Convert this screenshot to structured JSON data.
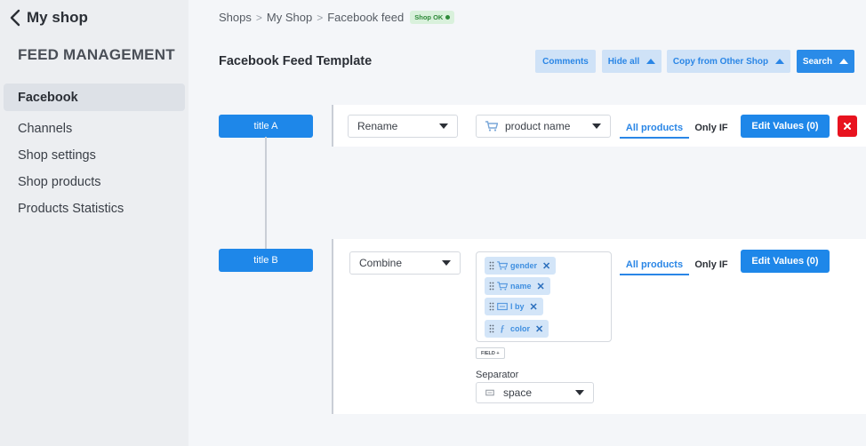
{
  "sidebar": {
    "back_label": "My shop",
    "section_title": "FEED MANAGEMENT",
    "items": [
      {
        "label": "Facebook",
        "active": true
      },
      {
        "label": "Channels"
      },
      {
        "label": "Shop settings"
      },
      {
        "label": "Shop products"
      },
      {
        "label": "Products Statistics"
      }
    ]
  },
  "breadcrumb": {
    "items": [
      "Shops",
      "My Shop",
      "Facebook feed"
    ],
    "badge": "Shop OK",
    "badge_color": "#2f8a3a"
  },
  "page": {
    "title": "Facebook Feed Template"
  },
  "toolbar": {
    "comments": "Comments",
    "hide_all": "Hide all",
    "copy": "Copy from Other Shop",
    "search": "Search"
  },
  "rules": [
    {
      "title": "title A",
      "action": "Rename",
      "field": "product name",
      "tab_all": "All products",
      "tab_only": "Only IF",
      "edit": "Edit Values (0)"
    },
    {
      "title": "title B",
      "action": "Combine",
      "tab_all": "All products",
      "tab_only": "Only IF",
      "edit": "Edit Values (0)",
      "chips": [
        {
          "label": "gender",
          "icon": "cart-icon"
        },
        {
          "label": "name",
          "icon": "cart-icon"
        },
        {
          "label": "l by",
          "icon": "text-field-icon"
        },
        {
          "label": "color",
          "icon": "function-icon"
        }
      ],
      "field_button": "FIELD +",
      "separator_label": "Separator",
      "separator_value": "space"
    }
  ],
  "colors": {
    "accent": "#1e87e9",
    "accent_light": "#cfe2f7",
    "danger": "#e8131f",
    "sidebar_bg": "#eceef1"
  }
}
